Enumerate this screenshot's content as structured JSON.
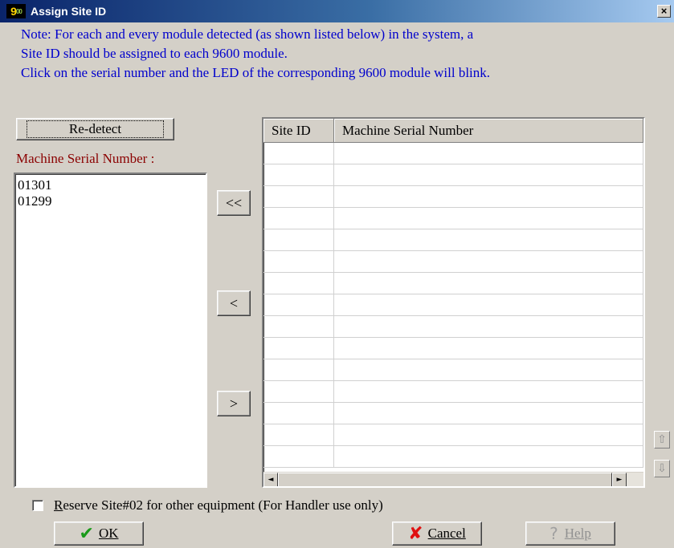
{
  "window": {
    "title": "Assign Site ID",
    "icon_text": "9",
    "icon_sub": "00",
    "close_label": "×"
  },
  "note": {
    "line1": "Note: For each and every module detected (as shown listed below) in the system, a",
    "line2": "Site ID should be assigned to each 9600 module.",
    "line3": "Click on the serial number and the LED of the corresponding 9600 module will blink."
  },
  "left_panel": {
    "redetect_label": "Re-detect",
    "list_label": "Machine Serial Number :",
    "serials": [
      "01301",
      "01299"
    ]
  },
  "transfer_buttons": {
    "all_left": "<<",
    "one_left": "<",
    "one_right": ">"
  },
  "grid": {
    "columns": [
      "Site ID",
      "Machine Serial Number"
    ],
    "rows": []
  },
  "scroll": {
    "left_arrow": "◄",
    "right_arrow": "►",
    "up_icon": "⇧",
    "down_icon": "⇩"
  },
  "reserve": {
    "checked": false,
    "label_first": "R",
    "label_rest": "eserve Site#02 for other equipment (For Handler use only)"
  },
  "footer": {
    "ok_icon": "✔",
    "ok_label": "OK",
    "cancel_icon": "✘",
    "cancel_label": "Cancel",
    "help_icon": "?",
    "help_label": "Help"
  }
}
